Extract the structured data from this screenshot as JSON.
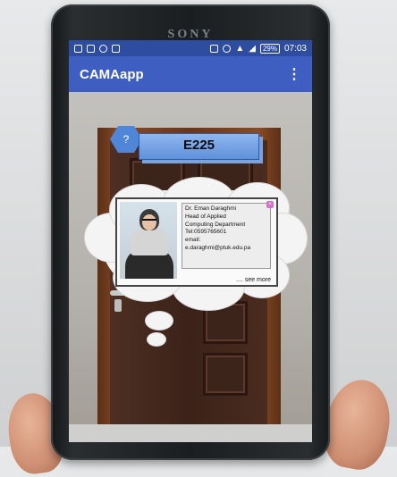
{
  "phone": {
    "brand": "SONY"
  },
  "status_bar": {
    "battery": "29%",
    "time": "07:03",
    "left_icons": [
      "facebook-icon",
      "gallery-icon",
      "whatsapp-icon",
      "sim-icon"
    ],
    "right_icons": [
      "vibrate-icon",
      "alarm-icon",
      "wifi-icon",
      "signal-icon"
    ]
  },
  "app_bar": {
    "title": "CAMAapp",
    "menu_icon": "overflow-menu-icon"
  },
  "room_sign": {
    "badge": "?",
    "number": "E225"
  },
  "contact_card": {
    "lines": [
      "Dr. Eman Daraghmi",
      "Head of Applied",
      "Computing Department",
      "Tel:0595765601",
      "email:",
      "e.daraghmi@ptuk.edu.pa"
    ],
    "see_more": ".... see more"
  }
}
